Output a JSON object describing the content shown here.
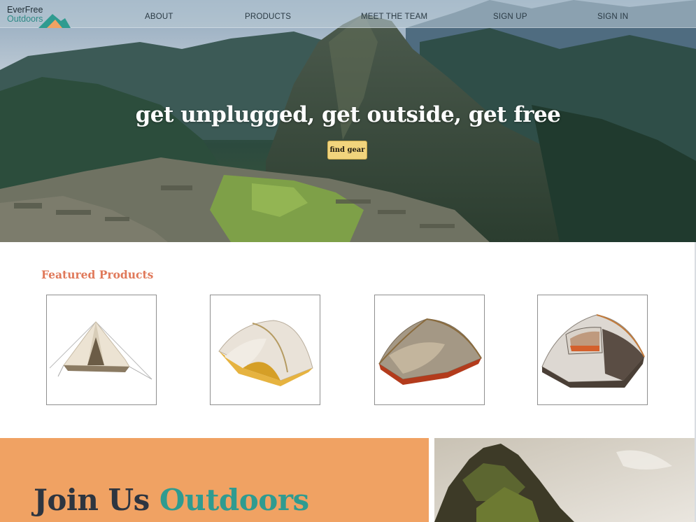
{
  "brand": {
    "line1": "EverFree",
    "line2": "Outdoors"
  },
  "nav": [
    {
      "label": "ABOUT"
    },
    {
      "label": "PRODUCTS"
    },
    {
      "label": "MEET THE TEAM"
    },
    {
      "label": "SIGN UP"
    },
    {
      "label": "SIGN IN"
    }
  ],
  "hero": {
    "title": "get unplugged, get outside, get free",
    "cta_label": "find gear"
  },
  "featured": {
    "heading": "Featured Products",
    "products": [
      {
        "icon": "bell-tent-icon"
      },
      {
        "icon": "yellow-backpacking-tent-icon"
      },
      {
        "icon": "red-dome-tent-icon"
      },
      {
        "icon": "gray-dome-tent-icon"
      }
    ]
  },
  "join": {
    "title_part1": "Join Us",
    "title_part2": "Outdoors"
  },
  "colors": {
    "accent_orange": "#f0a263",
    "heading_coral": "#e0795a",
    "teal": "#2f9b90",
    "cta_yellow": "#f1d47d",
    "dark_text": "#2d3540"
  }
}
